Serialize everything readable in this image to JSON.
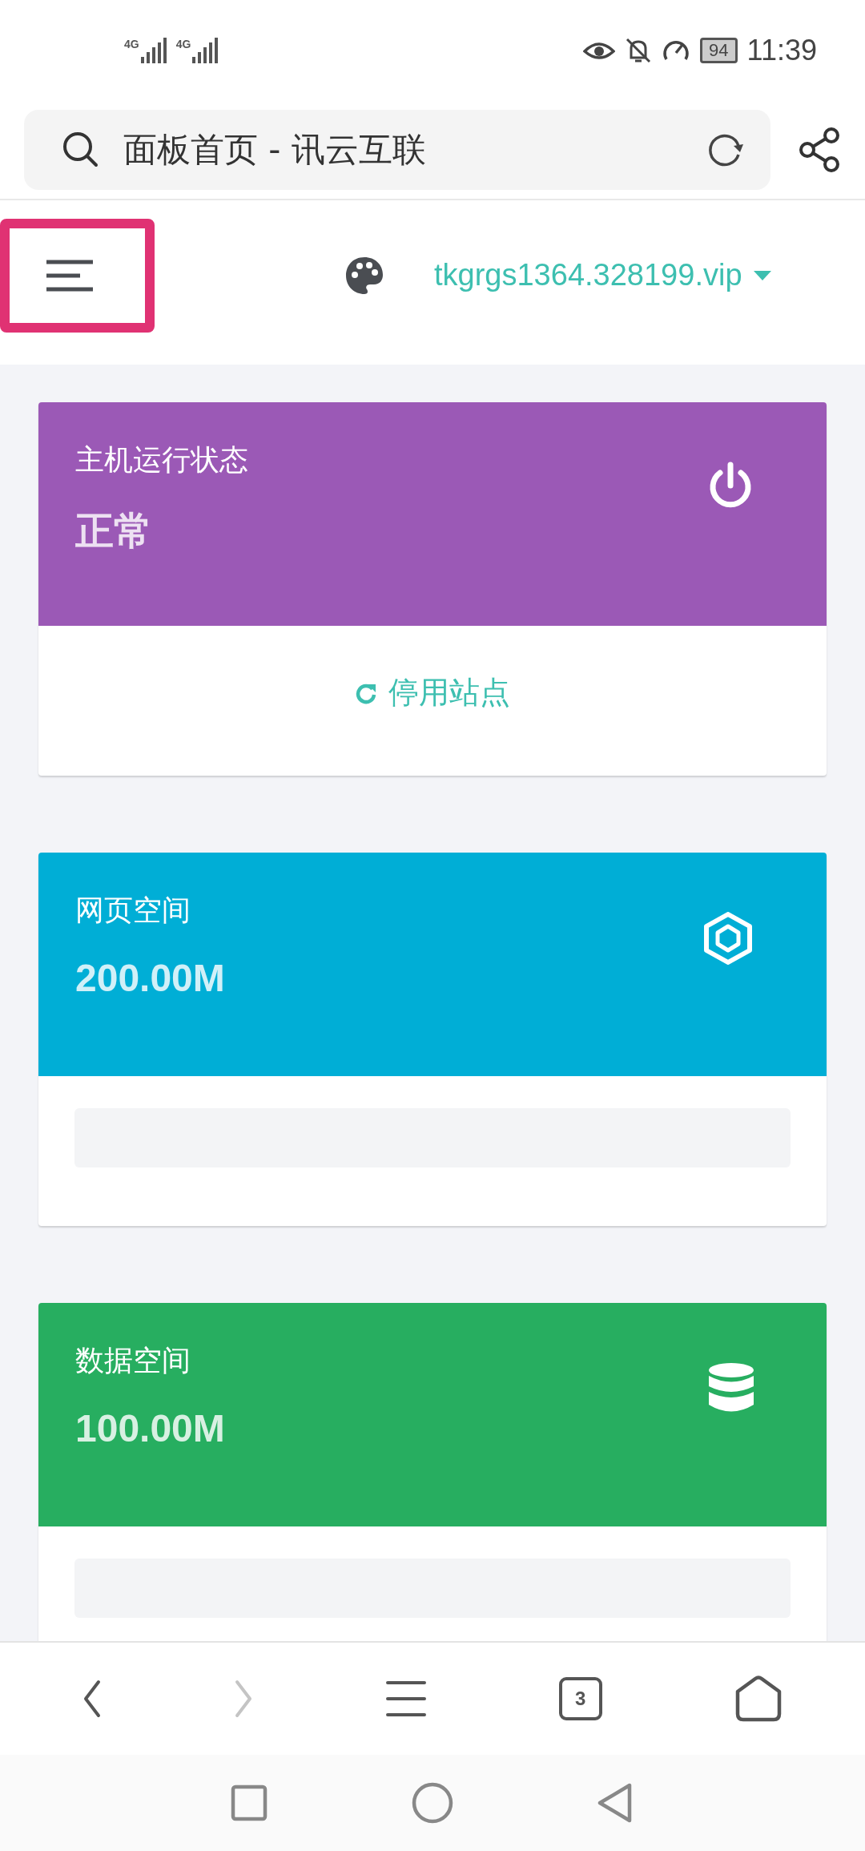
{
  "status_bar": {
    "signal_labels": [
      "4G",
      "4G"
    ],
    "battery": "94",
    "time": "11:39"
  },
  "address_bar": {
    "title": "面板首页 - 讯云互联"
  },
  "header": {
    "domain": "tkgrgs1364.328199.vip",
    "menu_highlighted": true
  },
  "cards": [
    {
      "kind": "status",
      "title": "主机运行状态",
      "value": "正常",
      "color": "#9b59b6",
      "action": "停用站点"
    },
    {
      "kind": "web_space",
      "title": "网页空间",
      "value": "200.00M",
      "color": "#00aed6"
    },
    {
      "kind": "db_space",
      "title": "数据空间",
      "value": "100.00M",
      "color": "#27ae60"
    }
  ],
  "browser_bar": {
    "tab_count": "3",
    "forward_disabled": true
  }
}
